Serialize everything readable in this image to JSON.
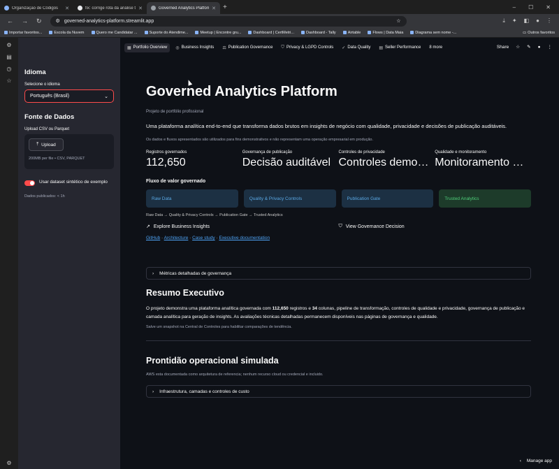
{
  "browser": {
    "tabs": [
      {
        "title": "Organização de Códigos",
        "active": false
      },
      {
        "title": "fix: corrige rota da análise técnica",
        "active": false
      },
      {
        "title": "Governed Analytics Platform · Streamlit",
        "active": true
      }
    ],
    "url": "governed-analytics-platform.streamlit.app",
    "bookmarks": [
      "Importar favoritos...",
      "Escola da Nuvem",
      "Quero me Candidatar ...",
      "Suporte do Atendime...",
      "Meetup | Encontre gru...",
      "Dashboard | CertMetri...",
      "Dashboard - Tally",
      "Airtable",
      "Flows | Data Maia",
      "Diagrama sem nome -..."
    ],
    "bookmarks_folder": "Outros favoritos"
  },
  "sidebar": {
    "language_heading": "Idioma",
    "language_label": "Selecione o idioma",
    "language_value": "Português (Brasil)",
    "data_heading": "Fonte de Dados",
    "upload_label": "Upload CSV ou Parquet",
    "upload_button": "Upload",
    "upload_hint": "200MB per file • CSV, PARQUET",
    "synthetic_label": "Usar dataset sintético de exemplo",
    "published": "Dados publicados: < 1h"
  },
  "nav": {
    "tabs": [
      "Portfolio Overview",
      "Business Insights",
      "Publication Governance",
      "Privacy & LGPD Controls",
      "Data Quality",
      "Seller Performance"
    ],
    "more": "8 more",
    "share": "Share"
  },
  "main": {
    "title": "Governed Analytics Platform",
    "subtitle": "Projeto de portfólio profissional",
    "lead": "Uma plataforma analítica end-to-end que transforma dados brutos em insights de negócio com qualidade, privacidade e decisões de publicação auditáveis.",
    "note": "Os dados e fluxos apresentados são utilizados para fins demonstrativos e não representam uma operação empresarial em produção.",
    "metrics": [
      {
        "label": "Registros governados",
        "value": "112,650"
      },
      {
        "label": "Governança de publicação",
        "value": "Decisão auditável"
      },
      {
        "label": "Controles de privacidade",
        "value": "Controles demonstrados"
      },
      {
        "label": "Qualidade e monitoramento",
        "value": "Monitoramento ativo"
      }
    ],
    "flow_title": "Fluxo de valor governado",
    "flow": [
      "Raw Data",
      "Quality & Privacy Controls",
      "Publication Gate",
      "Trusted Analytics"
    ],
    "flow_text": "Raw Data → Quality & Privacy Controls → Publication Gate → Trusted Analytics",
    "action_insights": "Explore Business Insights",
    "action_governance": "View Governance Decision",
    "links": [
      "GitHub",
      "Architecture",
      "Case study",
      "Executive documentation"
    ],
    "expander_metrics": "Métricas detalhadas de governança",
    "summary_title": "Resumo Executivo",
    "summary_p1": "O projeto demonstra uma plataforma analítica governada com ",
    "summary_records": "112,650",
    "summary_p2": " registros e ",
    "summary_cols": "34",
    "summary_p3": " colunas, pipeline de transformação, controles de qualidade e privacidade, governança de publicação e camada analítica para geração de insights. As avaliações técnicas detalhadas permanecem disponíveis nas páginas de governança e qualidade.",
    "summary_note": "Salve um snapshot na Central de Controles para habilitar comparações de tendência.",
    "ops_title": "Prontidão operacional simulada",
    "ops_note": "AWS esta documentada como arquitetura de referencia; nenhum recurso cloud ou credencial e incluido.",
    "expander_infra": "Infraestrutura, camadas e controles de custo",
    "manage": "Manage app"
  }
}
